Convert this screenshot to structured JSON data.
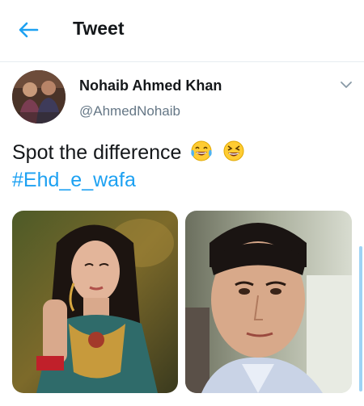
{
  "header": {
    "title": "Tweet",
    "back_icon": "arrow-left-icon"
  },
  "author": {
    "name": "Nohaib Ahmed Khan",
    "handle": "@AhmedNohaib",
    "menu_icon": "chevron-down-icon"
  },
  "tweet": {
    "text": "Spot the difference",
    "emojis": [
      "laughing-crying-emoji",
      "squinting-laughing-emoji"
    ],
    "hashtag": "#Ehd_e_wafa"
  },
  "media": [
    {
      "name": "photo-left",
      "subject": "woman-portrait"
    },
    {
      "name": "photo-right",
      "subject": "man-portrait"
    }
  ],
  "colors": {
    "accent": "#1da1f2",
    "text": "#14171a",
    "secondary": "#657786"
  }
}
